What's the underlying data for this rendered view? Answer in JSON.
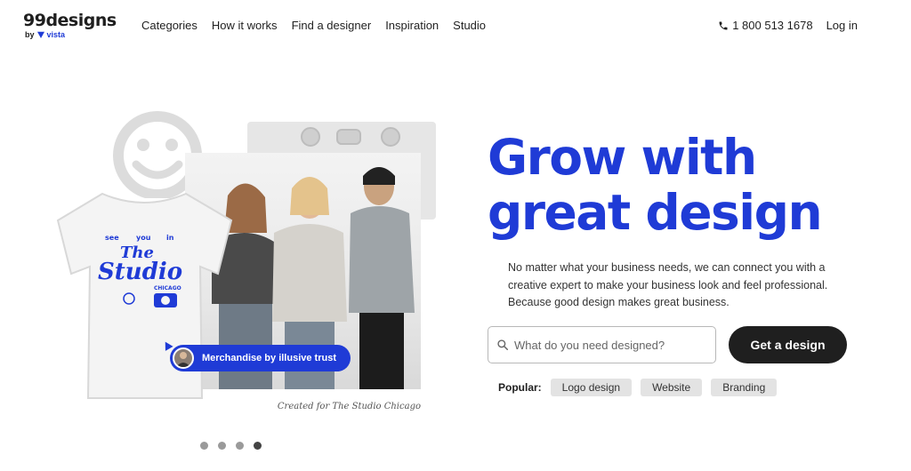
{
  "brand": {
    "logo_text": "99designs",
    "by_text": "by",
    "vista_text": "vista",
    "accent_color": "#1f3bd6"
  },
  "nav": {
    "items": [
      {
        "label": "Categories"
      },
      {
        "label": "How it works"
      },
      {
        "label": "Find a designer"
      },
      {
        "label": "Inspiration"
      },
      {
        "label": "Studio"
      }
    ]
  },
  "header_right": {
    "phone": "1 800 513 1678",
    "phone_icon": "phone-icon",
    "login": "Log in"
  },
  "hero": {
    "headline_line1": "Grow with",
    "headline_line2": "great design",
    "subtext": "No matter what your business needs, we can connect you with a creative expert to make your business look and feel professional. Because good design makes great business.",
    "search_placeholder": "What do you need designed?",
    "search_icon": "search-icon",
    "cta_label": "Get a design",
    "popular_label": "Popular:",
    "popular_items": [
      {
        "label": "Logo design"
      },
      {
        "label": "Website"
      },
      {
        "label": "Branding"
      }
    ]
  },
  "showcase": {
    "badge_text": "Merchandise by illusive trust",
    "caption": "Created for The Studio Chicago",
    "tshirt_text": {
      "line1": "see",
      "line2": "you",
      "line3": "in",
      "title1": "The",
      "title2": "Studio",
      "city": "CHICAGO"
    },
    "carousel": {
      "total": 4,
      "active_index": 3
    }
  }
}
